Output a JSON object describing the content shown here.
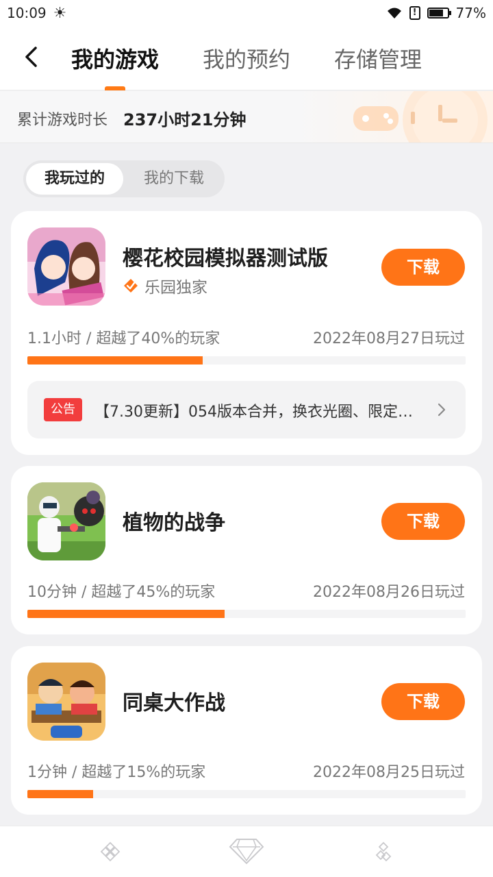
{
  "status_bar": {
    "time": "10:09",
    "battery": "77%"
  },
  "nav": {
    "tabs": [
      "我的游戏",
      "我的预约",
      "存储管理"
    ]
  },
  "summary": {
    "label": "累计游戏时长",
    "value": "237小时21分钟"
  },
  "segmented": {
    "options": [
      "我玩过的",
      "我的下载"
    ]
  },
  "games": [
    {
      "title": "樱花校园模拟器测试版",
      "exclusive_label": "乐园独家",
      "download_label": "下载",
      "stats": "1.1小时 / 超越了40%的玩家",
      "last_played": "2022年08月27日玩过",
      "progress": 0.4,
      "notice": {
        "tag": "公告",
        "text": "【7.30更新】054版本合并，换衣光圈、限定…"
      }
    },
    {
      "title": "植物的战争",
      "download_label": "下载",
      "stats": "10分钟 / 超越了45%的玩家",
      "last_played": "2022年08月26日玩过",
      "progress": 0.45
    },
    {
      "title": "同桌大作战",
      "download_label": "下载",
      "stats": "1分钟 / 超越了15%的玩家",
      "last_played": "2022年08月25日玩过",
      "progress": 0.15
    }
  ],
  "icons": [
    "back-arrow-icon",
    "sun-icon",
    "wifi-icon",
    "alert-icon",
    "battery-icon",
    "exclusive-badge-icon",
    "chevron-right-icon",
    "diamond-icon"
  ],
  "colors": {
    "accent": "#ff7417",
    "notice_tag": "#f23d3d"
  }
}
